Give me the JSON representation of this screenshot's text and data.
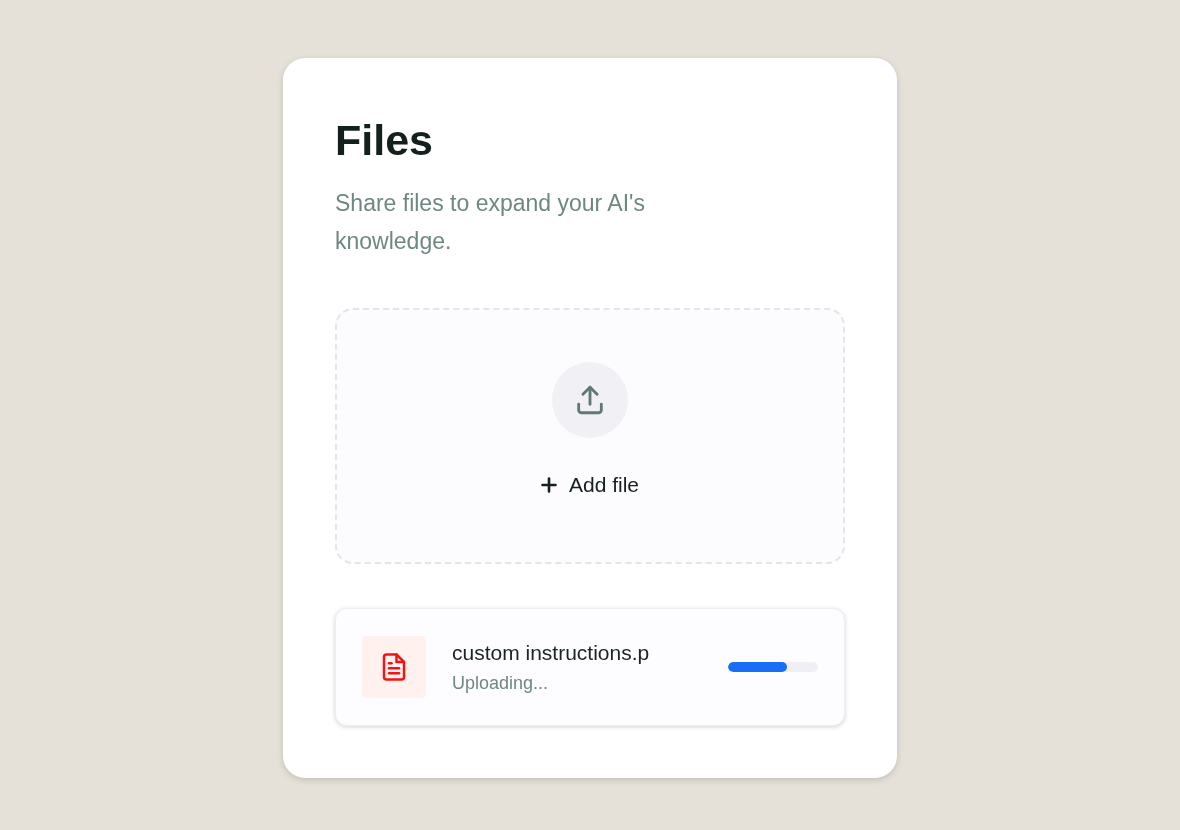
{
  "panel": {
    "title": "Files",
    "description": "Share files to expand your AI's knowledge.",
    "dropzone": {
      "action": "Add file"
    },
    "files": [
      {
        "name": "custom instructions.p",
        "status": "Uploading...",
        "level": 0.65
      }
    ]
  }
}
